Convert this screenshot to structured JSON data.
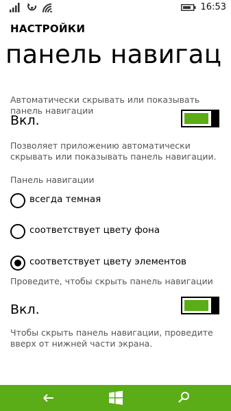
{
  "status_bar": {
    "time": "16:53"
  },
  "header": {
    "title": "НАСТРОЙКИ"
  },
  "page": {
    "title": "панель навигац"
  },
  "auto_hide": {
    "label": "Автоматически скрывать или показывать панель навигации",
    "value": "Вкл.",
    "toggle_on": true,
    "toggle_color": "#5aad16",
    "description": "Позволяет приложению автоматически скрывать или показывать панель навигации."
  },
  "nav_panel": {
    "label": "Панель навигации",
    "options": [
      {
        "label": "всегда темная",
        "selected": false
      },
      {
        "label": "соответствует цвету фона",
        "selected": false
      },
      {
        "label": "соответствует цвету элементов",
        "selected": true
      }
    ]
  },
  "swipe_hide": {
    "label": "Проведите, чтобы скрыть панель навигации",
    "value": "Вкл.",
    "toggle_on": true,
    "toggle_color": "#5aad16",
    "description": "Чтобы скрыть панель навигации, проведите вверх от нижней части экрана."
  },
  "nav_bar": {
    "color": "#5aad16",
    "buttons": [
      "back-icon",
      "windows-icon",
      "search-icon"
    ]
  }
}
